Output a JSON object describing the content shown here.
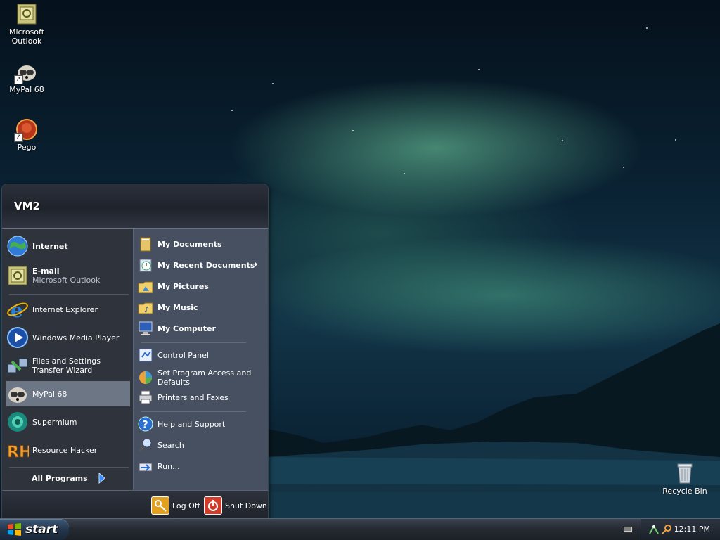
{
  "desktop": {
    "icons": [
      {
        "label": "Microsoft Outlook",
        "icon": "outlook-icon"
      },
      {
        "label": "MyPal 68",
        "icon": "mypal-icon"
      },
      {
        "label": "Pego",
        "icon": "pego-icon"
      },
      {
        "label": "Recycle Bin",
        "icon": "recycle-bin-icon"
      }
    ]
  },
  "start_menu": {
    "user": "VM2",
    "pinned": [
      {
        "label": "Internet",
        "icon": "globe-icon"
      },
      {
        "label": "E-mail",
        "sub": "Microsoft Outlook",
        "icon": "outlook-icon"
      }
    ],
    "recent": [
      {
        "label": "Internet Explorer",
        "icon": "internet-explorer-icon"
      },
      {
        "label": "Windows Media Player",
        "icon": "media-player-icon"
      },
      {
        "label": "Files and Settings Transfer Wizard",
        "icon": "transfer-wizard-icon"
      },
      {
        "label": "MyPal 68",
        "icon": "mypal-icon"
      },
      {
        "label": "Supermium",
        "icon": "supermium-icon"
      },
      {
        "label": "Resource Hacker",
        "icon": "resource-hacker-icon"
      }
    ],
    "all_programs": "All Programs",
    "places": [
      {
        "label": "My Documents",
        "icon": "documents-folder-icon"
      },
      {
        "label": "My Recent Documents",
        "icon": "recent-documents-icon"
      },
      {
        "label": "My Pictures",
        "icon": "pictures-folder-icon"
      },
      {
        "label": "My Music",
        "icon": "music-folder-icon"
      },
      {
        "label": "My Computer",
        "icon": "computer-icon"
      }
    ],
    "settings": [
      {
        "label": "Control Panel",
        "icon": "control-panel-icon"
      },
      {
        "label": "Set Program Access and Defaults",
        "icon": "program-access-icon"
      },
      {
        "label": "Printers and Faxes",
        "icon": "printer-icon"
      }
    ],
    "help": [
      {
        "label": "Help and Support",
        "icon": "help-icon"
      },
      {
        "label": "Search",
        "icon": "search-icon"
      },
      {
        "label": "Run...",
        "icon": "run-icon"
      }
    ],
    "log_off": "Log Off",
    "shut_down": "Shut Down"
  },
  "taskbar": {
    "start_label": "start",
    "clock": "12:11 PM"
  },
  "colors": {
    "menu_left_bg": "#2e333c",
    "menu_right_bg": "#465060",
    "hover_bg": "#6d7685"
  }
}
